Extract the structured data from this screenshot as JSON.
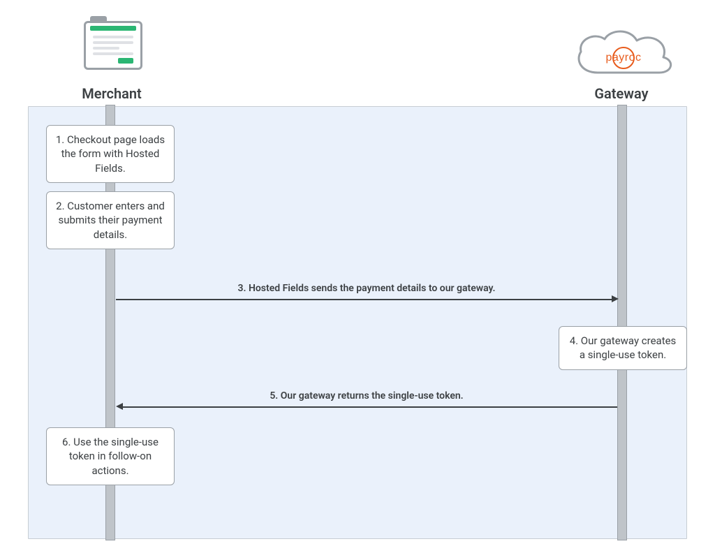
{
  "participants": {
    "merchant": "Merchant",
    "gateway": "Gateway",
    "gateway_brand": "payroc"
  },
  "steps": {
    "s1": "1. Checkout page loads the form with Hosted Fields.",
    "s2": "2. Customer enters and submits their payment details.",
    "s3": "3. Hosted Fields sends the payment details to our gateway.",
    "s4": "4. Our gateway creates a single-use token.",
    "s5": "5. Our gateway returns the single-use token.",
    "s6": "6. Use the single-use token in follow-on actions."
  },
  "chart_data": {
    "type": "sequence-diagram",
    "title": "",
    "participants": [
      "Merchant",
      "Gateway"
    ],
    "messages": [
      {
        "n": 1,
        "from": "Merchant",
        "to": "Merchant",
        "text": "Checkout page loads the form with Hosted Fields."
      },
      {
        "n": 2,
        "from": "Merchant",
        "to": "Merchant",
        "text": "Customer enters and submits their payment details."
      },
      {
        "n": 3,
        "from": "Merchant",
        "to": "Gateway",
        "text": "Hosted Fields sends the payment details to our gateway."
      },
      {
        "n": 4,
        "from": "Gateway",
        "to": "Gateway",
        "text": "Our gateway creates a single-use token."
      },
      {
        "n": 5,
        "from": "Gateway",
        "to": "Merchant",
        "text": "Our gateway returns the single-use token."
      },
      {
        "n": 6,
        "from": "Merchant",
        "to": "Merchant",
        "text": "Use the single-use token in follow-on actions."
      }
    ]
  }
}
